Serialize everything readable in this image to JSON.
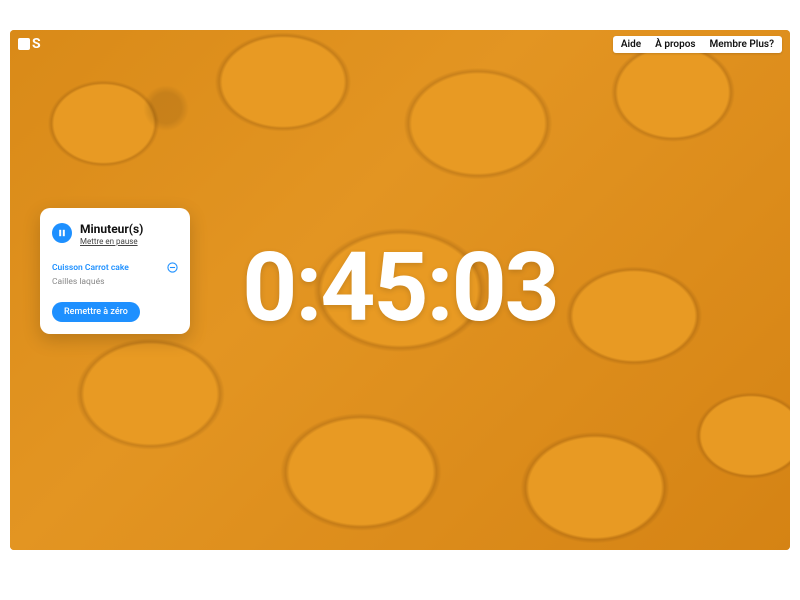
{
  "logo": {
    "letter": "S"
  },
  "nav": {
    "help": "Aide",
    "about": "À propos",
    "member": "Membre Plus?"
  },
  "timer": {
    "display": "0:45:03"
  },
  "card": {
    "title": "Minuteur(s)",
    "subtitle": "Mettre en pause",
    "timers": [
      {
        "label": "Cuisson Carrot cake",
        "active": true
      },
      {
        "label": "Cailles laqués",
        "active": false
      }
    ],
    "reset_label": "Remettre à zéro"
  },
  "colors": {
    "accent": "#1e90ff"
  }
}
